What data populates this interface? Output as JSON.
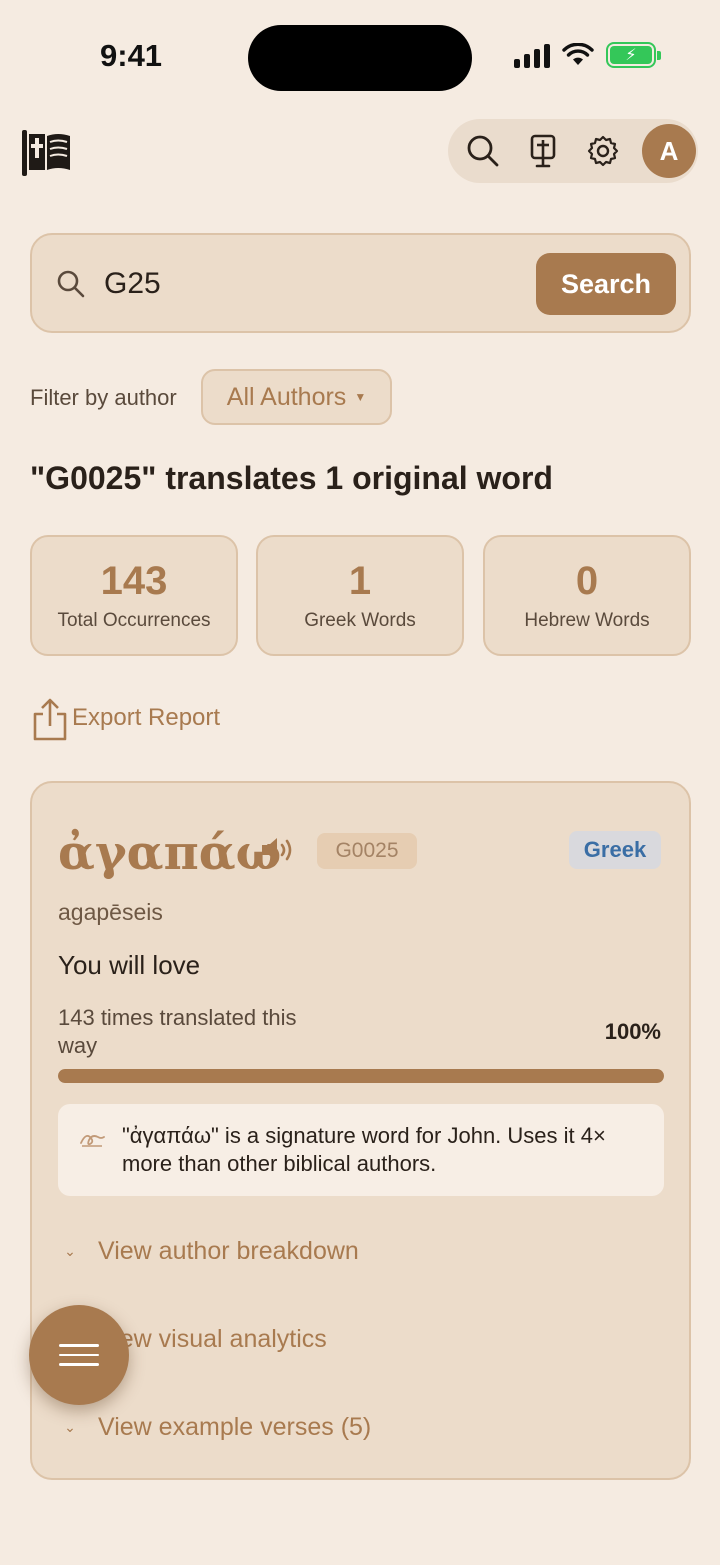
{
  "status_bar": {
    "time": "9:41"
  },
  "toolbar": {
    "icons": [
      "search-icon",
      "bible-scroll-icon",
      "gear-icon"
    ],
    "avatar_initial": "A"
  },
  "search": {
    "value": "G25",
    "button_label": "Search"
  },
  "filter": {
    "label": "Filter by author",
    "selected": "All Authors"
  },
  "heading": "\"G0025\" translates 1 original word",
  "stats": [
    {
      "value": "143",
      "label": "Total Occurrences"
    },
    {
      "value": "1",
      "label": "Greek Words"
    },
    {
      "value": "0",
      "label": "Hebrew Words"
    }
  ],
  "export_label": "Export Report",
  "word": {
    "lemma": "ἀγαπάω",
    "strongs": "G0025",
    "language": "Greek",
    "transliteration": "agapēseis",
    "gloss": "You will love",
    "count_text": "143 times translated this way",
    "percent_text": "100%",
    "percent_value": 1.0,
    "insight": "\"ἀγαπάω\" is a signature word for John. Uses it 4× more than other biblical authors.",
    "expanders": [
      "View author breakdown",
      "View visual analytics",
      "View example verses (5)"
    ]
  },
  "colors": {
    "accent": "#a87a4f",
    "background": "#f5ebe1",
    "card": "#ecdcca",
    "greek_badge": "#3a6ea5"
  }
}
